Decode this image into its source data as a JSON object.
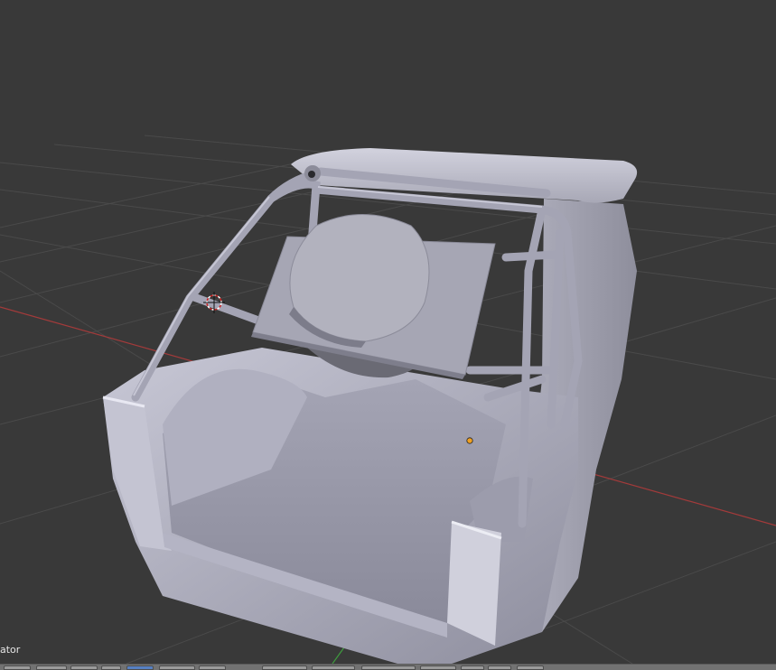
{
  "viewport": {
    "background": "#393939",
    "grid_color": "#4a4a4a",
    "x_axis_color": "#a33a3a",
    "y_axis_color": "#3e9a3e",
    "model_color": "#aaaabb",
    "cursor_icon": "3d-cursor-icon",
    "origin_icon": "object-origin-icon"
  },
  "operator_panel": {
    "label": "ator"
  },
  "header": {
    "button_count": 14
  }
}
